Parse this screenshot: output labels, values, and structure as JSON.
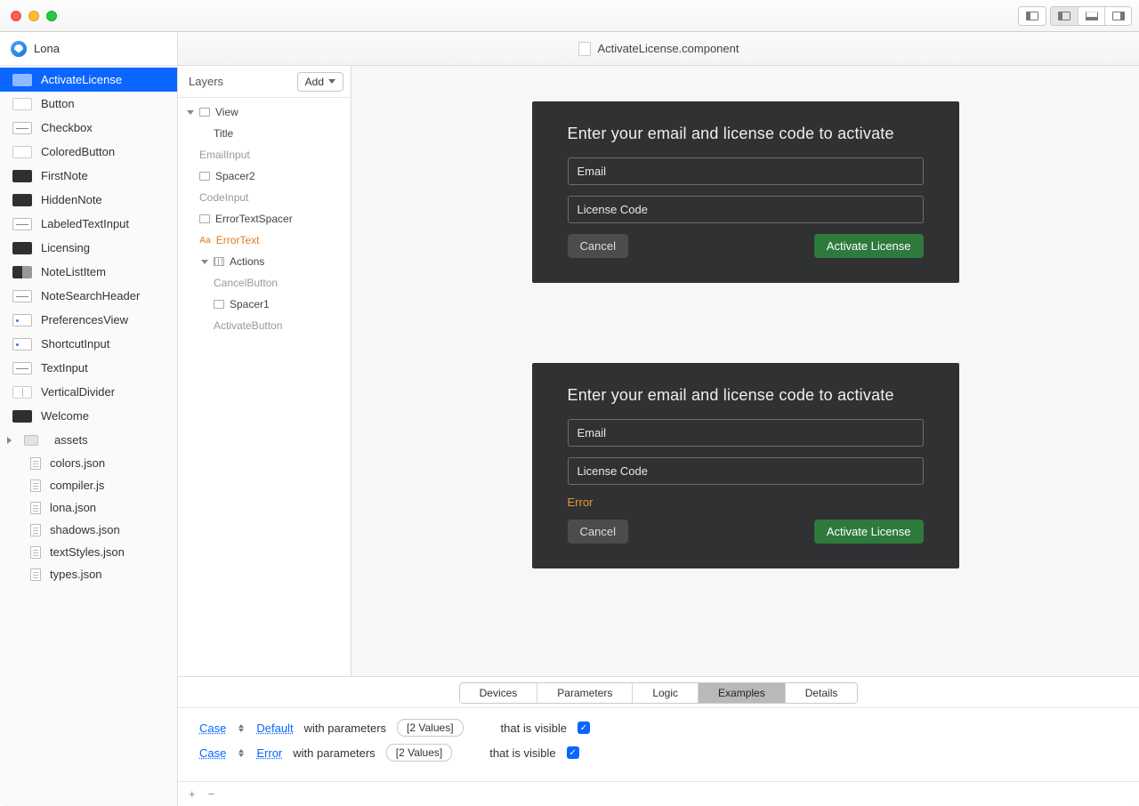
{
  "app": {
    "title": "Lona"
  },
  "document": {
    "title": "ActivateLicense.component"
  },
  "sidebar": {
    "items": [
      {
        "label": "ActivateLicense",
        "selected": true,
        "thumb": "dark"
      },
      {
        "label": "Button",
        "thumb": "blank"
      },
      {
        "label": "Checkbox",
        "thumb": "line"
      },
      {
        "label": "ColoredButton",
        "thumb": "blank"
      },
      {
        "label": "FirstNote",
        "thumb": "dark"
      },
      {
        "label": "HiddenNote",
        "thumb": "dark"
      },
      {
        "label": "LabeledTextInput",
        "thumb": "line"
      },
      {
        "label": "Licensing",
        "thumb": "dark"
      },
      {
        "label": "NoteListItem",
        "thumb": "two"
      },
      {
        "label": "NoteSearchHeader",
        "thumb": "line"
      },
      {
        "label": "PreferencesView",
        "thumb": "dots"
      },
      {
        "label": "ShortcutInput",
        "thumb": "dots"
      },
      {
        "label": "TextInput",
        "thumb": "line"
      },
      {
        "label": "VerticalDivider",
        "thumb": "vertical"
      },
      {
        "label": "Welcome",
        "thumb": "dark"
      }
    ],
    "folder": {
      "label": "assets"
    },
    "files": [
      {
        "label": "colors.json"
      },
      {
        "label": "compiler.js"
      },
      {
        "label": "lona.json"
      },
      {
        "label": "shadows.json"
      },
      {
        "label": "textStyles.json"
      },
      {
        "label": "types.json"
      }
    ]
  },
  "layers": {
    "title": "Layers",
    "add_label": "Add",
    "tree": [
      {
        "label": "View",
        "kind": "container",
        "indent": 0,
        "expand": true
      },
      {
        "label": "Title",
        "kind": "item",
        "indent": 2
      },
      {
        "label": "EmailInput",
        "kind": "muted",
        "indent": 1
      },
      {
        "label": "Spacer2",
        "kind": "box",
        "indent": 1
      },
      {
        "label": "CodeInput",
        "kind": "muted",
        "indent": 1
      },
      {
        "label": "ErrorTextSpacer",
        "kind": "box",
        "indent": 1
      },
      {
        "label": "ErrorText",
        "kind": "text",
        "indent": 1
      },
      {
        "label": "Actions",
        "kind": "hbox",
        "indent": 1,
        "expand": true
      },
      {
        "label": "CancelButton",
        "kind": "muted",
        "indent": 2
      },
      {
        "label": "Spacer1",
        "kind": "box",
        "indent": 2
      },
      {
        "label": "ActivateButton",
        "kind": "muted",
        "indent": 2
      }
    ]
  },
  "previews": [
    {
      "title": "Enter your email and license code to activate",
      "email": "Email",
      "code": "License Code",
      "error": null,
      "cancel": "Cancel",
      "activate": "Activate License"
    },
    {
      "title": "Enter your email and license code to activate",
      "email": "Email",
      "code": "License Code",
      "error": "Error",
      "cancel": "Cancel",
      "activate": "Activate License"
    }
  ],
  "tabs": [
    "Devices",
    "Parameters",
    "Logic",
    "Examples",
    "Details"
  ],
  "active_tab": "Examples",
  "cases": [
    {
      "case": "Case",
      "name": "Default",
      "with": "with parameters",
      "values": "[2 Values]",
      "visible": "that is visible",
      "checked": true
    },
    {
      "case": "Case",
      "name": "Error",
      "with": "with parameters",
      "values": "[2 Values]",
      "visible": "that is visible",
      "checked": true
    }
  ],
  "footer": {
    "plus": "+",
    "minus": "−"
  }
}
